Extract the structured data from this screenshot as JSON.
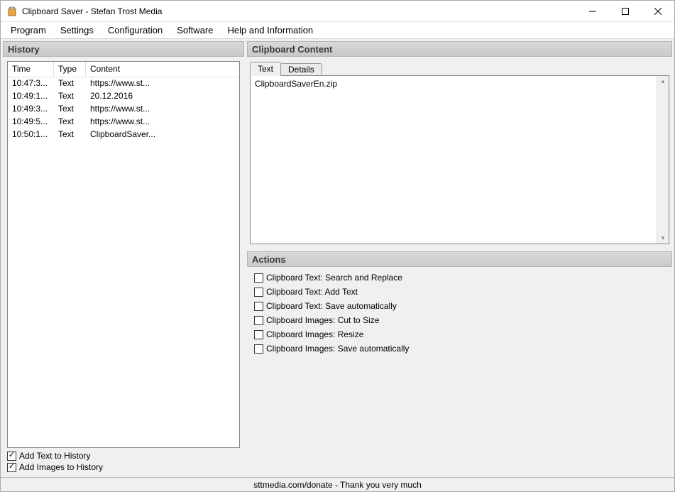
{
  "window": {
    "title": "Clipboard Saver - Stefan Trost Media"
  },
  "menu": {
    "items": [
      "Program",
      "Settings",
      "Configuration",
      "Software",
      "Help and Information"
    ]
  },
  "history": {
    "header": "History",
    "columns": {
      "time": "Time",
      "type": "Type",
      "content": "Content"
    },
    "rows": [
      {
        "time": "10:47:3...",
        "type": "Text",
        "content": "https://www.st..."
      },
      {
        "time": "10:49:1...",
        "type": "Text",
        "content": "20.12.2016"
      },
      {
        "time": "10:49:3...",
        "type": "Text",
        "content": "https://www.st..."
      },
      {
        "time": "10:49:5...",
        "type": "Text",
        "content": "https://www.st..."
      },
      {
        "time": "10:50:1...",
        "type": "Text",
        "content": "ClipboardSaver..."
      }
    ],
    "options": {
      "add_text": {
        "label": "Add Text to History",
        "checked": true
      },
      "add_images": {
        "label": "Add Images to History",
        "checked": true
      }
    }
  },
  "clipboard": {
    "header": "Clipboard Content",
    "tabs": {
      "text": "Text",
      "details": "Details"
    },
    "content_text": "ClipboardSaverEn.zip"
  },
  "actions": {
    "header": "Actions",
    "items": [
      {
        "label": "Clipboard Text: Search and Replace",
        "checked": false
      },
      {
        "label": "Clipboard Text: Add Text",
        "checked": false
      },
      {
        "label": "Clipboard Text: Save automatically",
        "checked": false
      },
      {
        "label": "Clipboard Images: Cut to Size",
        "checked": false
      },
      {
        "label": "Clipboard Images: Resize",
        "checked": false
      },
      {
        "label": "Clipboard Images: Save automatically",
        "checked": false
      }
    ]
  },
  "status": {
    "text": "sttmedia.com/donate - Thank you very much"
  }
}
